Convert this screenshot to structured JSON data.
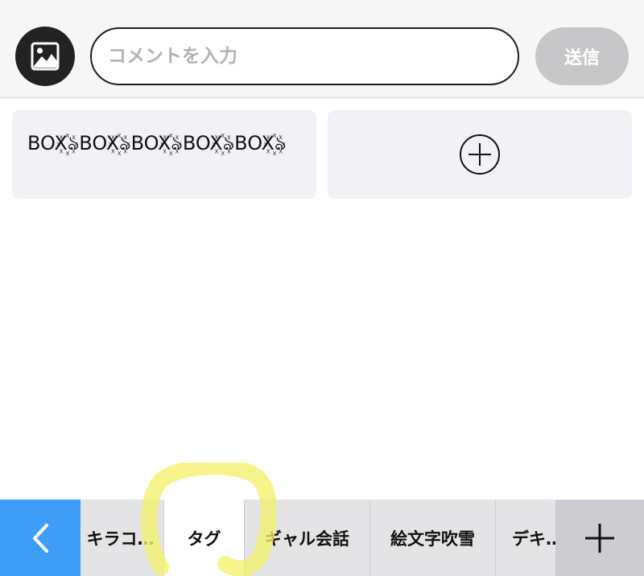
{
  "composer": {
    "image_button_icon": "image-icon",
    "input_placeholder": "コメントを入力",
    "input_value": "",
    "send_label": "送信"
  },
  "cards": [
    {
      "text": "BOX꙰ঌBOX꙰ঌBOX꙰ঌBOX꙰ঌBOX꙰ঌ"
    },
    {
      "icon": "plus-circle-icon"
    }
  ],
  "tabbar": {
    "back_icon": "chevron-left-icon",
    "tabs": [
      {
        "label": "キラコ…"
      },
      {
        "label": "タグ",
        "active": true
      },
      {
        "label": "ギャル会話"
      },
      {
        "label": "絵文字吹雪"
      },
      {
        "label": "デキ…"
      }
    ],
    "add_icon": "plus-icon"
  },
  "colors": {
    "accent_blue": "#3d9df7",
    "send_disabled": "#c7c7c9",
    "card_bg": "#f2f2f6",
    "highlight_yellow": "#f4f16a"
  }
}
